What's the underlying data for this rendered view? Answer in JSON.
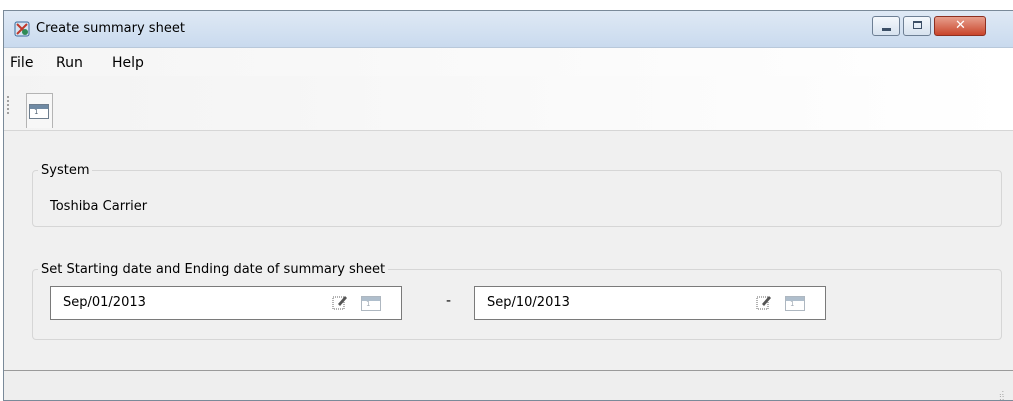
{
  "window": {
    "title": "Create summary sheet"
  },
  "title_buttons": {
    "minimize": "minimize",
    "maximize": "maximize",
    "close": "close"
  },
  "menu": {
    "items": [
      "File",
      "Run",
      "Help"
    ]
  },
  "toolbar": {
    "tabs": [
      {
        "icon": "calendar-icon",
        "label": "1"
      }
    ]
  },
  "system_group": {
    "legend": "System",
    "value": "Toshiba Carrier"
  },
  "dates_group": {
    "legend": "Set Starting date and Ending date of summary sheet",
    "start_date": "Sep/01/2013",
    "end_date": "Sep/10/2013",
    "separator": "-"
  },
  "colors": {
    "close_button": "#c9452b",
    "titlebar": "#dfe9f5"
  }
}
